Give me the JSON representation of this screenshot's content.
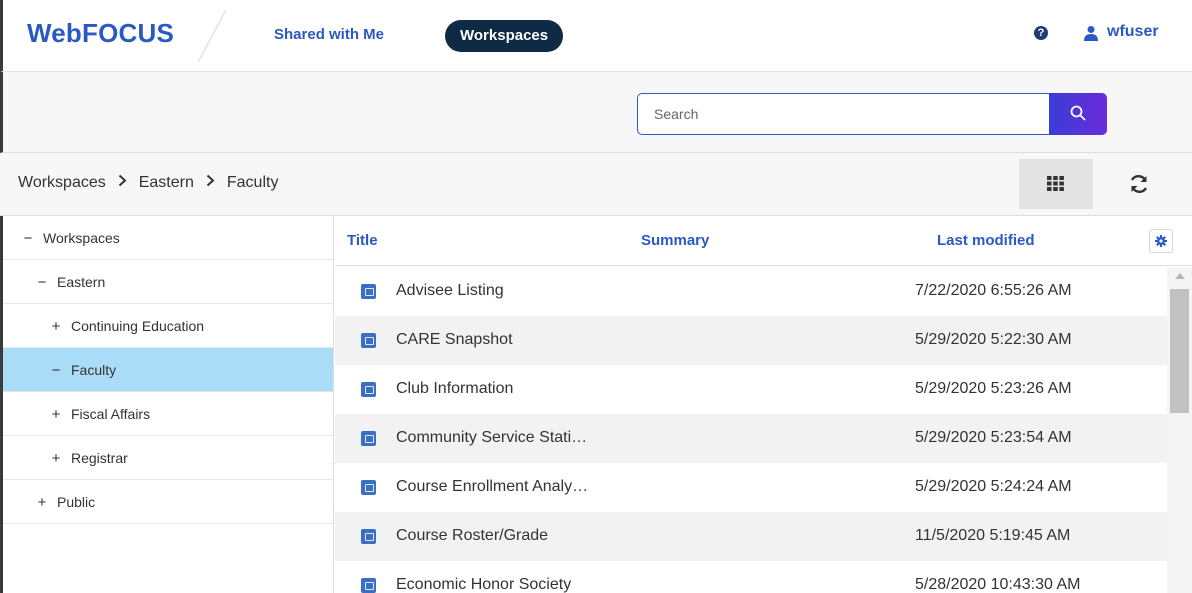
{
  "header": {
    "logo": "WebFOCUS",
    "nav_shared": "Shared with Me",
    "nav_workspaces": "Workspaces",
    "help_icon": "?",
    "user_name": "wfuser"
  },
  "search": {
    "placeholder": "Search"
  },
  "breadcrumb": [
    "Workspaces",
    "Eastern",
    "Faculty"
  ],
  "tree": [
    {
      "sign": "−",
      "label": "Workspaces",
      "level": 0,
      "selected": false
    },
    {
      "sign": "−",
      "label": "Eastern",
      "level": 1,
      "selected": false
    },
    {
      "sign": "+",
      "label": "Continuing Education",
      "level": 2,
      "selected": false
    },
    {
      "sign": "−",
      "label": "Faculty",
      "level": 2,
      "selected": true
    },
    {
      "sign": "+",
      "label": "Fiscal Affairs",
      "level": 2,
      "selected": false
    },
    {
      "sign": "+",
      "label": "Registrar",
      "level": 2,
      "selected": false
    },
    {
      "sign": "+",
      "label": "Public",
      "level": 1,
      "selected": false
    }
  ],
  "table": {
    "columns": {
      "title": "Title",
      "summary": "Summary",
      "last_modified": "Last modified"
    },
    "rows": [
      {
        "title": "Advisee Listing",
        "summary": "",
        "last_modified": "7/22/2020 6:55:26 AM"
      },
      {
        "title": "CARE Snapshot",
        "summary": "",
        "last_modified": "5/29/2020 5:22:30 AM"
      },
      {
        "title": "Club Information",
        "summary": "",
        "last_modified": "5/29/2020 5:23:26 AM"
      },
      {
        "title": "Community Service Stati…",
        "summary": "",
        "last_modified": "5/29/2020 5:23:54 AM"
      },
      {
        "title": "Course Enrollment Analy…",
        "summary": "",
        "last_modified": "5/29/2020 5:24:24 AM"
      },
      {
        "title": "Course Roster/Grade",
        "summary": "",
        "last_modified": "11/5/2020 5:19:45 AM"
      },
      {
        "title": "Economic Honor Society",
        "summary": "",
        "last_modified": "5/28/2020 10:43:30 AM"
      }
    ]
  },
  "colors": {
    "brand_blue": "#2b59c3",
    "nav_active_bg": "#0f2a44",
    "selected_tree_bg": "#a9dcf6",
    "search_button_start": "#3a3dd6",
    "search_button_end": "#6a2bd9"
  },
  "icons": {
    "help": "help-icon",
    "user": "user-icon",
    "search": "search-icon",
    "grid_view": "grid-view-icon",
    "refresh": "refresh-icon",
    "settings": "gear-icon",
    "file": "report-file-icon",
    "collapse": "chevron-left-icon"
  }
}
